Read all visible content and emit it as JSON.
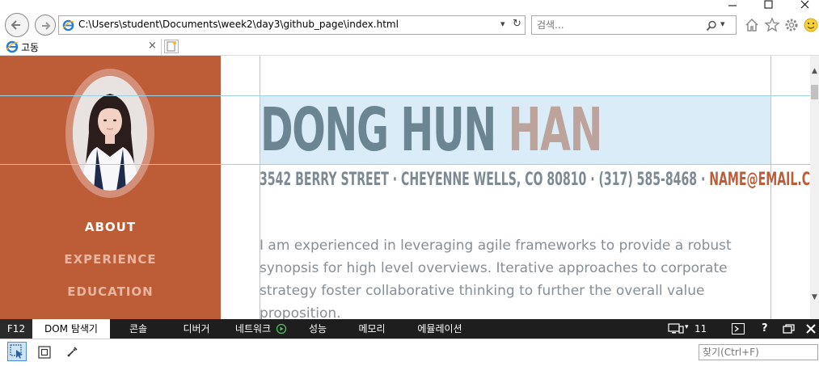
{
  "browser": {
    "address_url": "C:\\Users\\student\\Documents\\week2\\day3\\github_page\\index.html",
    "search_placeholder": "검색...",
    "tab_title": "고동",
    "tab_close": "×"
  },
  "page": {
    "first_name": "DONG HUN",
    "last_name": "HAN",
    "contact": "3542 BERRY STREET · CHEYENNE WELLS, CO 80810 · (317) 585-8468 ·",
    "email": "NAME@EMAIL.COM",
    "bio": "I am experienced in leveraging agile frameworks to provide a robust synopsis for high level overviews. Iterative approaches to corporate strategy foster collaborative thinking to further the overall value proposition.",
    "nav": [
      {
        "label": "ABOUT",
        "active": true
      },
      {
        "label": "EXPERIENCE",
        "active": false
      },
      {
        "label": "EDUCATION",
        "active": false
      }
    ],
    "colors": {
      "sidebar": "#bd5d38",
      "active_nav": "#ffffff",
      "inactive_nav": "#e8b5a0",
      "first_name": "#6b8592",
      "last_name": "#bca39b"
    }
  },
  "devtools": {
    "tabs": [
      "F12",
      "DOM 탐색기",
      "콘솔",
      "디버거",
      "네트워크",
      "성능",
      "메모리",
      "에뮬레이션"
    ],
    "doc_mode": "11",
    "help": "?",
    "find_placeholder": "찾기(Ctrl+F)"
  }
}
